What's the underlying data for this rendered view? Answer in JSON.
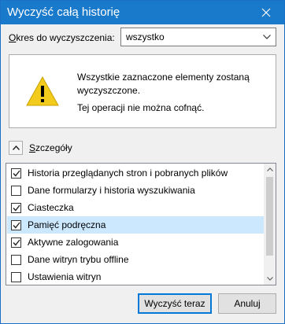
{
  "dialog": {
    "title": "Wyczyść całą historię"
  },
  "period": {
    "label_accel": "O",
    "label_rest": "kres do wyczyszczenia:",
    "selected": "wszystko"
  },
  "info": {
    "line1": "Wszystkie zaznaczone elementy zostaną wyczyszczone.",
    "line2": "Tej operacji nie można cofnąć."
  },
  "details": {
    "label_accel": "S",
    "label_rest": "zczegóły",
    "expanded": true
  },
  "items": [
    {
      "label": "Historia przeglądanych stron i pobranych plików",
      "checked": true,
      "selected": false
    },
    {
      "label": "Dane formularzy i historia wyszukiwania",
      "checked": false,
      "selected": false
    },
    {
      "label": "Ciasteczka",
      "checked": true,
      "selected": false
    },
    {
      "label": "Pamięć podręczna",
      "checked": true,
      "selected": true
    },
    {
      "label": "Aktywne zalogowania",
      "checked": true,
      "selected": false
    },
    {
      "label": "Dane witryn trybu offline",
      "checked": false,
      "selected": false
    },
    {
      "label": "Ustawienia witryn",
      "checked": false,
      "selected": false
    }
  ],
  "buttons": {
    "clear": "Wyczyść teraz",
    "cancel": "Anuluj"
  },
  "icons": {
    "close": "close-icon",
    "dropdown": "chevron-down-icon",
    "warning": "warning-icon",
    "toggle": "chevron-up-icon",
    "checkbox": "checkmark-icon"
  },
  "colors": {
    "titlebar": "#1979ca",
    "selection": "#cce8ff",
    "default_button_border": "#0078d7"
  }
}
